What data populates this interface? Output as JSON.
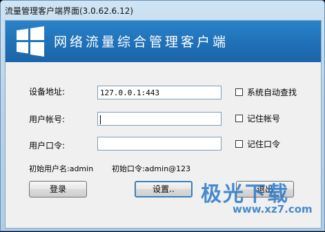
{
  "window": {
    "title": "流量管理客户端界面(3.0.62.6.12)"
  },
  "banner": {
    "title": "网络流量综合管理客户端",
    "logo_icon": "windows-logo-icon"
  },
  "form": {
    "device_address": {
      "label": "设备地址:",
      "value": "127.0.0.1:443"
    },
    "username": {
      "label": "用户帐号:",
      "value": ""
    },
    "password": {
      "label": "用户口令:",
      "value": ""
    }
  },
  "options": {
    "auto_search": {
      "label": "系统自动查找",
      "checked": false
    },
    "remember_account": {
      "label": "记住帐号",
      "checked": false
    },
    "remember_password": {
      "label": "记住口令",
      "checked": false
    }
  },
  "info": {
    "initial_user": "初始用户名:admin",
    "initial_password": "初始口令:admin@123"
  },
  "buttons": {
    "login": "登录",
    "settings": "设置..",
    "exit": "退出"
  },
  "watermark": {
    "brand": "极光下载",
    "url": "www.xz7.com"
  },
  "colors": {
    "banner": "#1f6fb5",
    "accent": "#3c7fb1"
  }
}
